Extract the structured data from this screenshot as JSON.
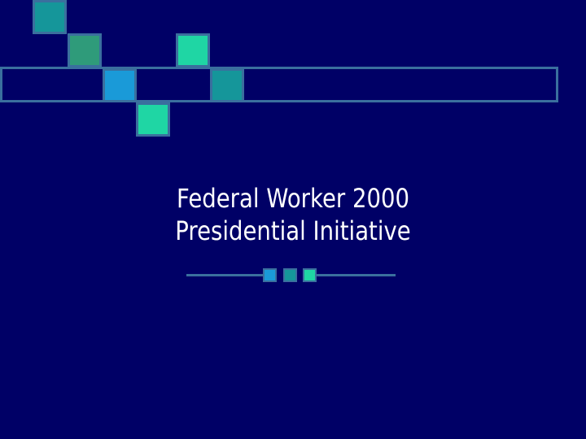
{
  "slide": {
    "title_line1": "Federal Worker 2000",
    "title_line2": "Presidential Initiative"
  },
  "colors": {
    "background": "#000066",
    "outline": "#3a6f9e",
    "text": "#ffffff",
    "square_teal": "#15969a",
    "square_green": "#2f9b7a",
    "square_mint": "#1fd6a4",
    "square_blue": "#1a9ad8"
  }
}
